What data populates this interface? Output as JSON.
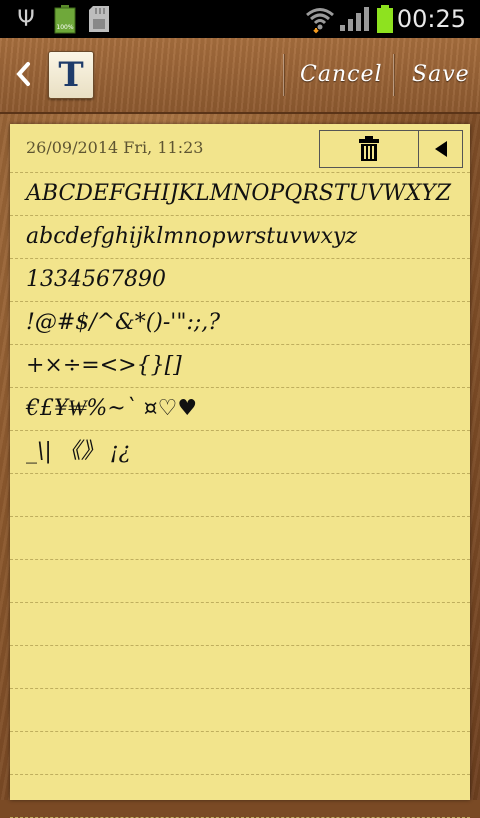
{
  "status_bar": {
    "time": "00:25",
    "battery_label": "100%"
  },
  "action_bar": {
    "font_glyph": "T",
    "cancel_label": "Cancel",
    "save_label": "Save"
  },
  "note": {
    "date": "26/09/2014 Fri, 11:23",
    "lines": [
      "ABCDEFGHIJKLMNOPQRSTUVWXYZ",
      "abcdefghijklmnopwrstuvwxyz",
      "1334567890",
      "!@#$/^&*()-'\":;,?",
      "+×÷=<>{}[]",
      "€£¥₩%~` ¤♡♥",
      "_\\| 《》 ¡¿",
      "",
      "",
      "",
      "",
      "",
      "",
      "",
      ""
    ]
  },
  "colors": {
    "paper": "#f2e48c",
    "wood": "#8e5a2e",
    "title_glyph": "#1f3c6a"
  }
}
